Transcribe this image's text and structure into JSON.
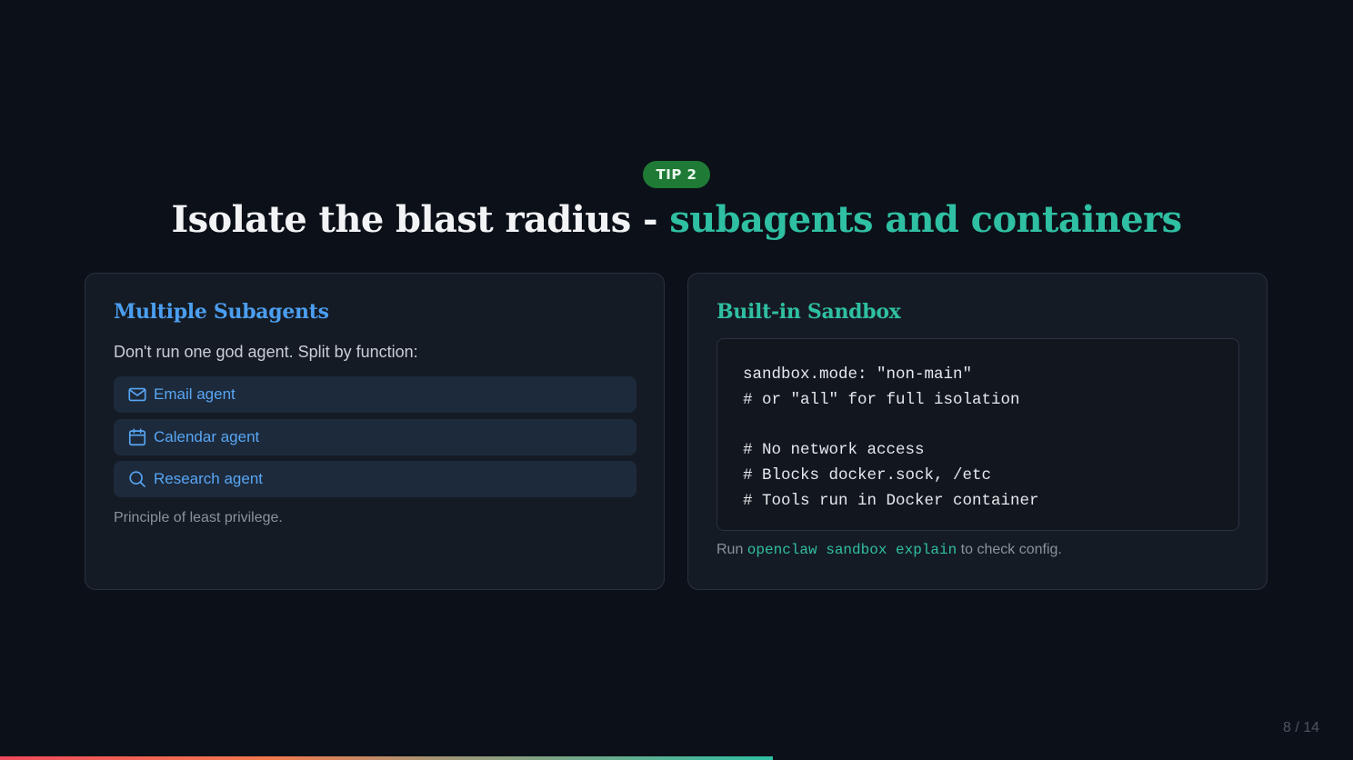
{
  "badge": "TIP 2",
  "title": {
    "main": "Isolate the blast radius - ",
    "accent": "subagents and containers"
  },
  "left_card": {
    "heading": "Multiple Subagents",
    "intro": "Don't run one god agent. Split by function:",
    "agents": [
      {
        "label": "Email agent",
        "icon": "mail-icon"
      },
      {
        "label": "Calendar agent",
        "icon": "calendar-icon"
      },
      {
        "label": "Research agent",
        "icon": "search-icon"
      }
    ],
    "footnote": "Principle of least privilege."
  },
  "right_card": {
    "heading": "Built-in Sandbox",
    "code": [
      "sandbox.mode: \"non-main\"",
      "# or \"all\" for full isolation",
      "# No network access",
      "# Blocks docker.sock, /etc",
      "# Tools run in Docker container"
    ],
    "footnote_prefix": "Run ",
    "footnote_command": "openclaw sandbox explain",
    "footnote_suffix": " to check config."
  },
  "page": "8 / 14",
  "progress": {
    "current": 8,
    "total": 14
  },
  "colors": {
    "background": "#0c1018",
    "badge": "#1f7a35",
    "accent_teal": "#2fbfa2",
    "accent_blue": "#4b9ef0",
    "card": "#151b24"
  }
}
